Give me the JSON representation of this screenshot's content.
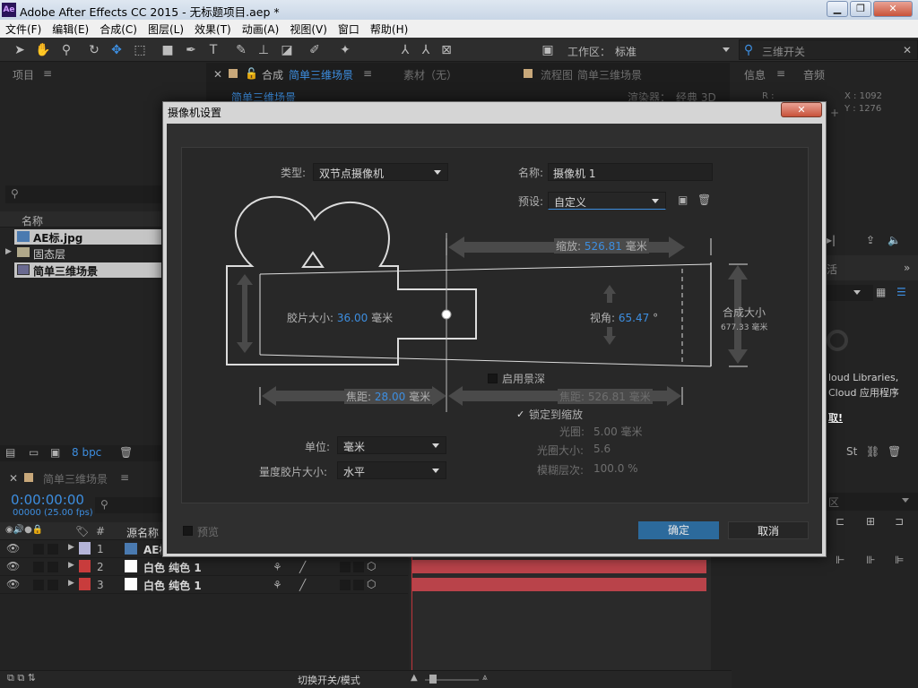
{
  "window": {
    "title": "Adobe After Effects CC 2015 - 无标题项目.aep *",
    "icon": "Ae"
  },
  "menu": [
    "文件(F)",
    "编辑(E)",
    "合成(C)",
    "图层(L)",
    "效果(T)",
    "动画(A)",
    "视图(V)",
    "窗口",
    "帮助(H)"
  ],
  "toolbar": {
    "workspace_label": "工作区：",
    "workspace_value": "标准",
    "search_placeholder": "三维开关"
  },
  "project": {
    "title": "项目",
    "column": "名称",
    "items": [
      "AE标.jpg",
      "固态层",
      "简单三维场景"
    ],
    "bpc": "8 bpc"
  },
  "comp": {
    "tab_label": "合成",
    "comp_name": "简单三维场景",
    "footage_tab": "素材（无）",
    "flow_tab": "流程图",
    "flow_name": "简单三维场景",
    "inner_tab": "简单三维场景",
    "renderer_label": "渲染器：",
    "renderer": "经典 3D"
  },
  "info": {
    "title": "信息",
    "audio_title": "音频",
    "x": "X : 1092",
    "y": "Y : 1276",
    "r": "R :"
  },
  "right": {
    "lib1": "loud Libraries,",
    "lib2": "Cloud 应用程序",
    "lib3": "取!"
  },
  "dialog": {
    "title": "摄像机设置",
    "type_label": "类型:",
    "type_value": "双节点摄像机",
    "name_label": "名称:",
    "name_value": "摄像机 1",
    "preset_label": "预设:",
    "preset_value": "自定义",
    "zoom_label": "缩放:",
    "zoom_value": "526.81",
    "unit_mm": "毫米",
    "film_label": "胶片大小:",
    "film_value": "36.00",
    "angle_label": "视角:",
    "angle_value": "65.47",
    "degree": "°",
    "comp_size_label": "合成大小",
    "comp_size_value": "677.33 毫米",
    "dof_label": "启用景深",
    "focal_label": "焦距:",
    "focal_value": "28.00",
    "focus_dist_label": "焦距:",
    "focus_dist_value": "526.81",
    "lock_label": "锁定到缩放",
    "aperture_label": "光圈:",
    "aperture_value": "5.00 毫米",
    "fstop_label": "光圈大小:",
    "fstop_value": "5.6",
    "blur_label": "模糊层次:",
    "blur_value": "100.0 %",
    "units_label": "单位:",
    "units_value": "毫米",
    "measure_label": "量度胶片大小:",
    "measure_value": "水平",
    "preview_label": "预览",
    "ok": "确定",
    "cancel": "取消"
  },
  "timeline": {
    "comp_name": "简单三维场景",
    "timecode": "0:00:00:00",
    "fps": "00000 (25.00 fps)",
    "source_header": "源名称",
    "hash_header": "#",
    "rows": [
      {
        "num": "1",
        "name": "AE标.jpg",
        "color": "#b4b4d8"
      },
      {
        "num": "2",
        "name": "白色 纯色 1",
        "color": "#c83c3c"
      },
      {
        "num": "3",
        "name": "白色 纯色 1",
        "color": "#c83c3c"
      }
    ],
    "toggle_label": "切换开关/模式"
  },
  "colors": {
    "accent": "#3d8ee0",
    "ok_button": "#2c6a9c",
    "layer_bar": "#b9434a"
  }
}
